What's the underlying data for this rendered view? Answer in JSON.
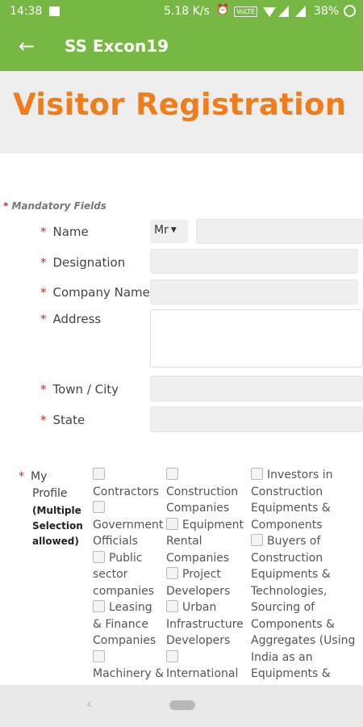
{
  "status_bar": {
    "time": "14:38",
    "net_speed": "5.18 K/s",
    "volte": "VoLTE",
    "battery_pct": "38%",
    "icons": [
      "image-icon",
      "alarm-icon",
      "volte-icon",
      "wifi-icon",
      "signal-icon",
      "battery-icon"
    ]
  },
  "app_bar": {
    "back_glyph": "←",
    "title": "SS Excon19"
  },
  "page_title": "Visitor Registration",
  "mandatory_note": "Mandatory Fields",
  "required_marker": "*",
  "fields": {
    "name": {
      "label": "Name",
      "salutation": "Mr",
      "value": ""
    },
    "designation": {
      "label": "Designation",
      "value": ""
    },
    "company": {
      "label": "Company Name",
      "value": ""
    },
    "address": {
      "label": "Address",
      "value": ""
    },
    "town": {
      "label": "Town / City",
      "value": ""
    },
    "state": {
      "label": "State",
      "value": ""
    }
  },
  "profile": {
    "label_line1": "My",
    "label_line2": "Profile",
    "note_line1": "(Multiple",
    "note_line2": "Selection",
    "note_line3": "allowed)",
    "col1": {
      "opt1": "Contractors",
      "opt2_l1": "Government",
      "opt2_l2": "Officials",
      "opt3_l1": "Public",
      "opt3_l2": "sector",
      "opt3_l3": "companies",
      "opt4_l1": "Leasing",
      "opt4_l2": "& Finance",
      "opt4_l3": "Companies",
      "opt5_l1": "Machinery &"
    },
    "col2": {
      "opt1_l1": "Construction",
      "opt1_l2": "Companies",
      "opt2_l1": "Equipment",
      "opt2_l2": "Rental",
      "opt2_l3": "Companies",
      "opt3_l1": "Project",
      "opt3_l2": "Developers",
      "opt4_l1": "Urban",
      "opt4_l2": "Infrastructure",
      "opt4_l3": "Developers",
      "opt5_l1": "International"
    },
    "col3": {
      "opt1_l1": "Investors in",
      "opt1_l2": "Construction",
      "opt1_l3": "Equipments &",
      "opt1_l4": "Components",
      "opt2_l1": "Buyers of",
      "opt2_l2": "Construction",
      "opt2_l3": "Equipments &",
      "opt2_l4": "Technologies,",
      "opt2_l5": "Sourcing of",
      "opt2_l6": "Components &",
      "opt2_l7": "Aggregates (Using",
      "opt2_l8": "India as an",
      "opt2_l9": "Equipments &"
    }
  },
  "colors": {
    "app_bar": "#76b843",
    "title": "#ef7d1a",
    "required": "#d8262d"
  }
}
